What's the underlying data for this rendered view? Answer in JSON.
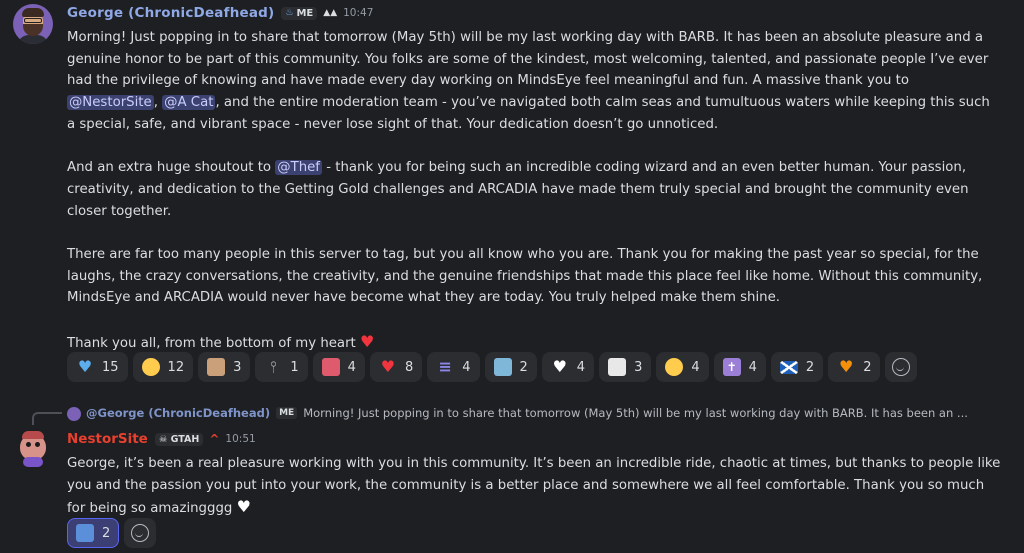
{
  "message1": {
    "username": "George (ChronicDeafhead)",
    "badge": "ME",
    "timestamp": "10:47",
    "paragraphs": [
      [
        {
          "t": "Morning! Just popping in to share that tomorrow (May 5th) will be my last working day with BARB. It has been an absolute pleasure and a genuine honor to be part of this community. You folks are some of the kindest, most welcoming, talented, and passionate people I’ve ever had the privilege of knowing and have made every day working on MindsEye feel meaningful and fun. A massive thank you to "
        },
        {
          "m": "@NestorSite"
        },
        {
          "t": ", "
        },
        {
          "m": "@A Cat"
        },
        {
          "t": ", and the entire moderation team - you’ve navigated both calm seas and tumultuous waters while keeping this such a special, safe, and vibrant space - never lose sight of that. Your dedication doesn’t go unnoticed."
        }
      ],
      [
        {
          "t": "And an extra huge shoutout to "
        },
        {
          "m": "@Thef"
        },
        {
          "t": " - thank you for being such an incredible coding wizard and an even better human. Your passion, creativity, and dedication to the Getting Gold challenges and ARCADIA have made them truly special and brought the community even closer together."
        }
      ],
      [
        {
          "t": "There are far too many people in this server to tag, but you all know who you are. Thank you for making the past year so special, for the laughs, the crazy conversations, the creativity, and the genuine friendships that made this place feel like home. Without this community, MindsEye and ARCADIA would never have become what they are today. You truly helped make them shine."
        }
      ],
      [
        {
          "t": "Thank you all, from the bottom of my heart "
        }
      ]
    ],
    "reactions": [
      {
        "icon": "blue-heart-icon",
        "count": "15"
      },
      {
        "icon": "crying-face-icon",
        "count": "12"
      },
      {
        "icon": "owl-icon",
        "count": "3"
      },
      {
        "icon": "microphone-icon",
        "count": "1"
      },
      {
        "icon": "cat-emote-icon",
        "count": "4"
      },
      {
        "icon": "red-heart-icon",
        "count": "8"
      },
      {
        "icon": "lines-emote-icon",
        "count": "4"
      },
      {
        "icon": "blob-emote-icon",
        "count": "2"
      },
      {
        "icon": "white-heart-icon",
        "count": "4"
      },
      {
        "icon": "goat-icon",
        "count": "3"
      },
      {
        "icon": "pleading-face-icon",
        "count": "4"
      },
      {
        "icon": "latin-cross-icon",
        "count": "4"
      },
      {
        "icon": "scotland-flag-icon",
        "count": "2"
      },
      {
        "icon": "orange-heart-icon",
        "count": "2"
      }
    ]
  },
  "message2": {
    "reply": {
      "username": "@George (ChronicDeafhead)",
      "badge": "ME",
      "preview": "Morning! Just popping in to share that tomorrow (May 5th) will be my last working day with BARB. It has been an ..."
    },
    "username": "NestorSite",
    "tag": "GTAH",
    "timestamp": "10:51",
    "text": "George, it’s been a real pleasure working with you in this community. It’s been an incredible ride, chaotic at times, but thanks to people like you and the passion you put into your work, the community is a better place and somewhere we all feel comfortable. Thank you so much for being so amazingggg ",
    "reactions": [
      {
        "icon": "hug-emote-icon",
        "count": "2"
      }
    ]
  },
  "colors": {
    "background": "#1e1f22",
    "username_george": "#8fa8e6",
    "username_nestor": "#e8402f",
    "mention_bg": "#3c4270",
    "reaction_bg": "#2b2d31",
    "reaction_active_border": "#5865f2"
  }
}
